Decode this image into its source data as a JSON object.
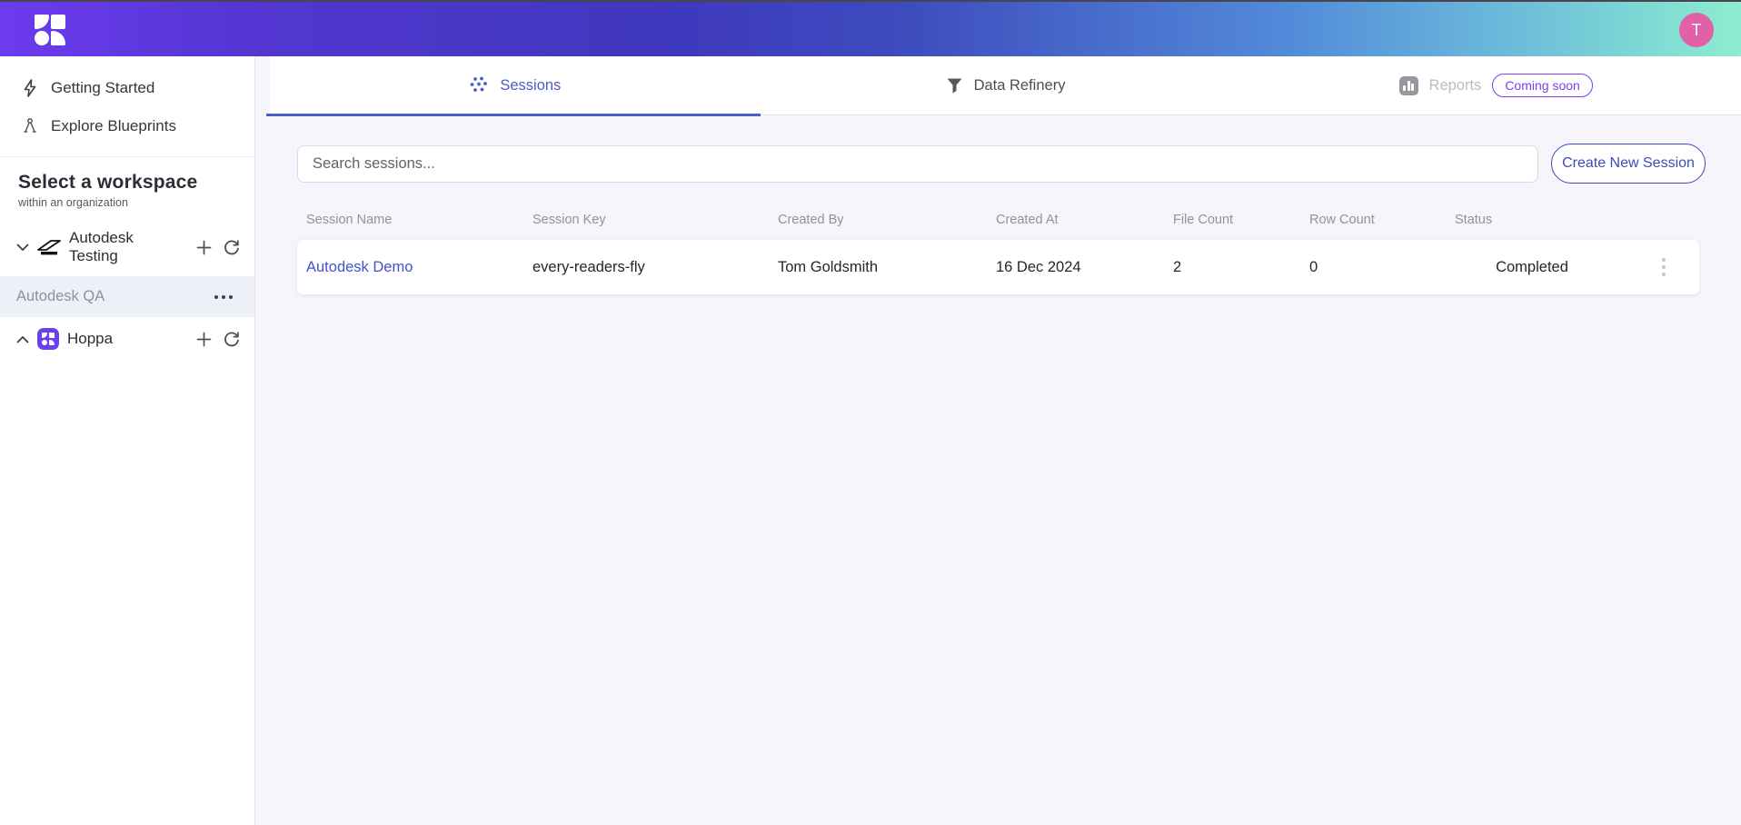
{
  "header": {
    "avatar_initial": "T"
  },
  "sidebar": {
    "nav": [
      {
        "label": "Getting Started",
        "icon": "lightning-icon"
      },
      {
        "label": "Explore Blueprints",
        "icon": "compass-icon"
      }
    ],
    "section_title": "Select a workspace",
    "section_subtitle": "within an organization",
    "workspaces": [
      {
        "name": "Autodesk Testing",
        "state": "expanded",
        "icon": "autodesk-logo"
      },
      {
        "name": "Autodesk QA",
        "selected": true
      },
      {
        "name": "Hoppa",
        "state": "collapsed",
        "icon": "hoppa-logo"
      }
    ]
  },
  "tabs": [
    {
      "label": "Sessions",
      "icon": "dots-cluster-icon",
      "active": true
    },
    {
      "label": "Data Refinery",
      "icon": "funnel-icon",
      "active": false
    },
    {
      "label": "Reports",
      "icon": "bar-chart-icon",
      "badge": "Coming soon",
      "disabled": true
    }
  ],
  "toolbar": {
    "search_placeholder": "Search sessions...",
    "create_button": "Create New Session"
  },
  "table": {
    "columns": [
      "Session Name",
      "Session Key",
      "Created By",
      "Created At",
      "File Count",
      "Row Count",
      "Status"
    ],
    "rows": [
      {
        "session_name": "Autodesk Demo",
        "session_key": "every-readers-fly",
        "created_by": "Tom Goldsmith",
        "created_at": "16 Dec 2024",
        "file_count": "2",
        "row_count": "0",
        "status": "Completed"
      }
    ]
  },
  "colors": {
    "header_gradient_start": "#6d3bee",
    "header_gradient_mid": "#3e4cbe",
    "header_gradient_end": "#8dedd0",
    "accent_indigo": "#4a5cc5",
    "badge_purple": "#7a3ff2",
    "avatar_pink": "#e160a7",
    "main_background": "#f5f5fb",
    "link_blue": "#4353c9"
  }
}
